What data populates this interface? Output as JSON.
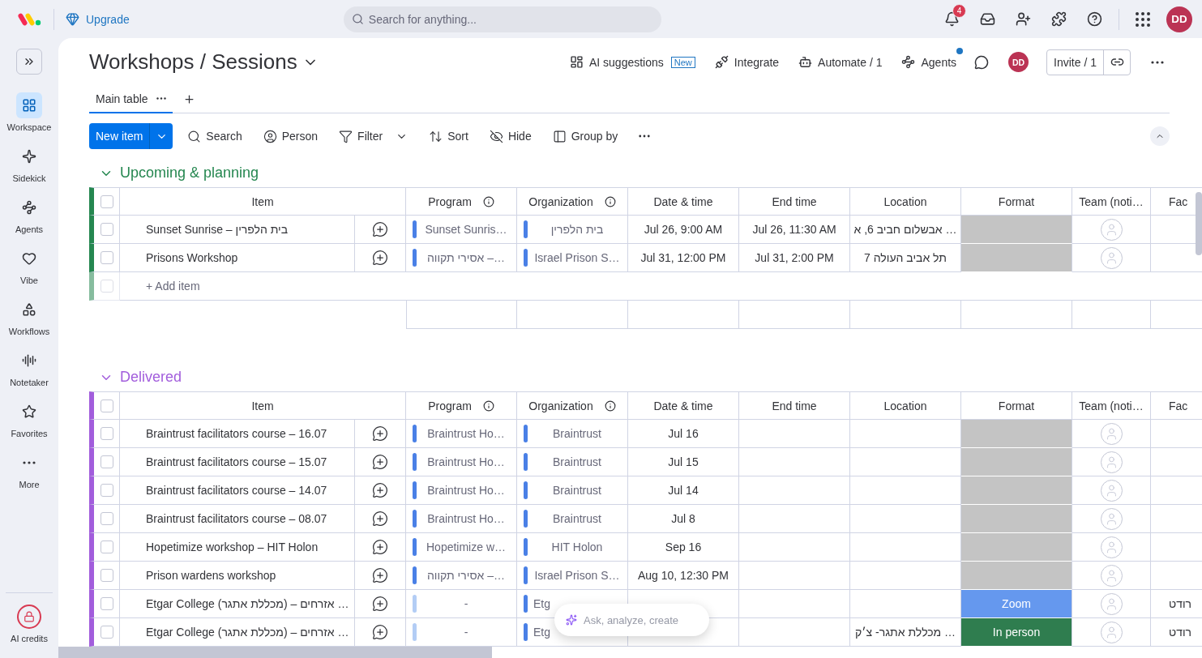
{
  "topbar": {
    "upgrade": "Upgrade",
    "search": {
      "placeholder": "Search for anything..."
    },
    "notifications": "4",
    "avatar": "DD"
  },
  "sidebar": {
    "items": [
      {
        "kind": "workspace",
        "label": "Workspace",
        "selected": true
      },
      {
        "kind": "sidekick",
        "label": "Sidekick",
        "selected": false
      },
      {
        "kind": "agents",
        "label": "Agents",
        "selected": false
      },
      {
        "kind": "vibe",
        "label": "Vibe",
        "selected": false
      },
      {
        "kind": "workflows",
        "label": "Workflows",
        "selected": false
      },
      {
        "kind": "notetaker",
        "label": "Notetaker",
        "selected": false
      },
      {
        "kind": "favorites",
        "label": "Favorites",
        "selected": false
      },
      {
        "kind": "more",
        "label": "More",
        "selected": false
      }
    ],
    "credits": "AI credits"
  },
  "board": {
    "title": "Workshops / Sessions",
    "actions": [
      {
        "kind": "ai",
        "label": "AI suggestions",
        "badge": "New"
      },
      {
        "kind": "integrate",
        "label": "Integrate"
      },
      {
        "kind": "automate",
        "label": "Automate / 1"
      },
      {
        "kind": "agents",
        "label": "Agents",
        "notice": true
      }
    ],
    "avatar": "DD",
    "invite": "Invite / 1",
    "tabs": [
      {
        "label": "Main table",
        "selected": true
      }
    ],
    "toolbar": {
      "new_item": "New item",
      "tools": [
        {
          "kind": "search",
          "label": "Search"
        },
        {
          "kind": "person",
          "label": "Person"
        },
        {
          "kind": "filter",
          "label": "Filter"
        },
        {
          "kind": "sort",
          "label": "Sort"
        },
        {
          "kind": "hide",
          "label": "Hide"
        },
        {
          "kind": "group",
          "label": "Group by"
        }
      ]
    }
  },
  "groups": [
    {
      "title": "Upcoming & planning",
      "color": "#258750",
      "expanded": true,
      "all_checked": false,
      "columns": [
        {
          "label": "Item"
        },
        {
          "label": "Program",
          "info": true
        },
        {
          "label": "Organization",
          "info": true
        },
        {
          "label": "Date & time"
        },
        {
          "label": "End time"
        },
        {
          "label": "Location"
        },
        {
          "label": "Format"
        },
        {
          "label": "Team (noti…"
        },
        {
          "label": "Fac"
        }
      ],
      "rows": [
        {
          "checked": false,
          "item": "Sunset Sunrise – בית הלפרין",
          "program": {
            "text": "Sunset Sunris…",
            "color": "#4a80e6"
          },
          "organization": {
            "text": "בית הלפרין",
            "color": "#4a80e6"
          },
          "date": "Jul 26, 9:00 AM",
          "end": "Jul 26, 11:30 AM",
          "location": "אבשלום חביב 6, א …",
          "format": {
            "color": "#c4c4c4"
          }
        },
        {
          "checked": false,
          "item": "Prisons Workshop",
          "program": {
            "text": "אסירי תקווה –…",
            "color": "#4a80e6"
          },
          "organization": {
            "text": "Israel Prison S…",
            "color": "#4a80e6"
          },
          "date": "Jul 31, 12:00 PM",
          "end": "Jul 31, 2:00 PM",
          "location": "תל אביב העולה 7",
          "format": {
            "color": "#c4c4c4"
          }
        }
      ],
      "add_item": {
        "label": "+ Add item",
        "checked": false
      }
    },
    {
      "title": "Delivered",
      "color": "#a25ddc",
      "expanded": true,
      "all_checked": false,
      "columns": [
        {
          "label": "Item"
        },
        {
          "label": "Program",
          "info": true
        },
        {
          "label": "Organization",
          "info": true
        },
        {
          "label": "Date & time"
        },
        {
          "label": "End time"
        },
        {
          "label": "Location"
        },
        {
          "label": "Format"
        },
        {
          "label": "Team (noti…"
        },
        {
          "label": "Fac"
        }
      ],
      "rows": [
        {
          "checked": false,
          "item": "Braintrust facilitators course – 16.07",
          "program": {
            "text": "Braintrust Ho…",
            "color": "#4a80e6"
          },
          "organization": {
            "text": "Braintrust",
            "color": "#4a80e6"
          },
          "date": "Jul 16",
          "format": {
            "color": "#c4c4c4"
          }
        },
        {
          "checked": false,
          "item": "Braintrust facilitators course – 15.07",
          "program": {
            "text": "Braintrust Ho…",
            "color": "#4a80e6"
          },
          "organization": {
            "text": "Braintrust",
            "color": "#4a80e6"
          },
          "date": "Jul 15",
          "format": {
            "color": "#c4c4c4"
          }
        },
        {
          "checked": false,
          "item": "Braintrust facilitators course – 14.07",
          "program": {
            "text": "Braintrust Ho…",
            "color": "#4a80e6"
          },
          "organization": {
            "text": "Braintrust",
            "color": "#4a80e6"
          },
          "date": "Jul 14",
          "format": {
            "color": "#c4c4c4"
          }
        },
        {
          "checked": false,
          "item": "Braintrust facilitators course – 08.07",
          "program": {
            "text": "Braintrust Ho…",
            "color": "#4a80e6"
          },
          "organization": {
            "text": "Braintrust",
            "color": "#4a80e6"
          },
          "date": "Jul 8",
          "format": {
            "color": "#c4c4c4"
          }
        },
        {
          "checked": false,
          "item": "Hopetimize workshop – HIT Holon",
          "program": {
            "text": "Hopetimize w…",
            "color": "#4a80e6"
          },
          "organization": {
            "text": "HIT Holon",
            "color": "#4a80e6"
          },
          "date": "Sep 16",
          "format": {
            "color": "#c4c4c4"
          }
        },
        {
          "checked": false,
          "item": "Prison wardens workshop",
          "program": {
            "text": "אסירי תקווה –…",
            "color": "#4a80e6"
          },
          "organization": {
            "text": "Israel Prison S…",
            "color": "#4a80e6"
          },
          "date": "Aug 10, 12:30 PM",
          "format": {
            "color": "#c4c4c4"
          }
        },
        {
          "checked": false,
          "item": "Etgar College (מכללת אתגר) – אזרחים …",
          "program": {
            "text": "-",
            "color": "#b3cdf5"
          },
          "organization": {
            "text": "Etg",
            "color": "#4a80e6",
            "cut": true
          },
          "format": {
            "text": "Zoom",
            "color": "#6598ee"
          },
          "fac": "רודט"
        },
        {
          "checked": false,
          "item": "Etgar College (מכללת אתגר) – אזרחים …",
          "program": {
            "text": "-",
            "color": "#b3cdf5"
          },
          "organization": {
            "text": "Etg",
            "color": "#4a80e6",
            "cut": true
          },
          "location": "מכללת אתגר- צ׳ק …",
          "format": {
            "text": "In person",
            "color": "#2f7d4f"
          },
          "fac": "רודט"
        }
      ]
    }
  ],
  "ask": {
    "placeholder": "Ask, analyze, create"
  }
}
